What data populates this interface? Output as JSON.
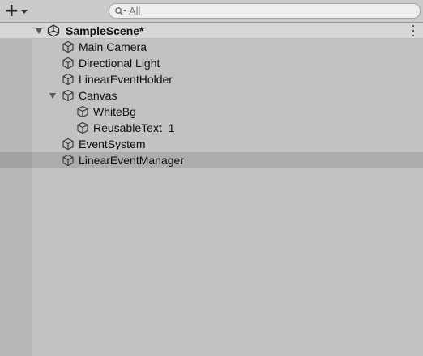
{
  "toolbar": {
    "add_icon": "plus-icon",
    "dropdown_icon": "caret-down-icon",
    "search": {
      "icon": "search-icon",
      "placeholder": "All",
      "value": ""
    }
  },
  "scene": {
    "name": "SampleScene*",
    "icon": "unity-scene-icon",
    "menu_icon": "more-vertical-icon"
  },
  "hierarchy": [
    {
      "label": "Main Camera",
      "icon": "gameobject-cube-icon",
      "depth": 0,
      "expanded": null,
      "selected": false
    },
    {
      "label": "Directional Light",
      "icon": "gameobject-cube-icon",
      "depth": 0,
      "expanded": null,
      "selected": false
    },
    {
      "label": "LinearEventHolder",
      "icon": "gameobject-cube-icon",
      "depth": 0,
      "expanded": null,
      "selected": false
    },
    {
      "label": "Canvas",
      "icon": "gameobject-cube-icon",
      "depth": 0,
      "expanded": true,
      "selected": false
    },
    {
      "label": "WhiteBg",
      "icon": "gameobject-cube-icon",
      "depth": 1,
      "expanded": null,
      "selected": false
    },
    {
      "label": "ReusableText_1",
      "icon": "gameobject-cube-icon",
      "depth": 1,
      "expanded": null,
      "selected": false
    },
    {
      "label": "EventSystem",
      "icon": "gameobject-cube-icon",
      "depth": 0,
      "expanded": null,
      "selected": false
    },
    {
      "label": "LinearEventManager",
      "icon": "gameobject-cube-icon",
      "depth": 0,
      "expanded": null,
      "selected": true
    }
  ],
  "colors": {
    "panel_bg": "#c2c2c2",
    "header_bg": "#d7d7d7",
    "gutter": "#b7b7b7",
    "selected_row": "#adadad"
  }
}
